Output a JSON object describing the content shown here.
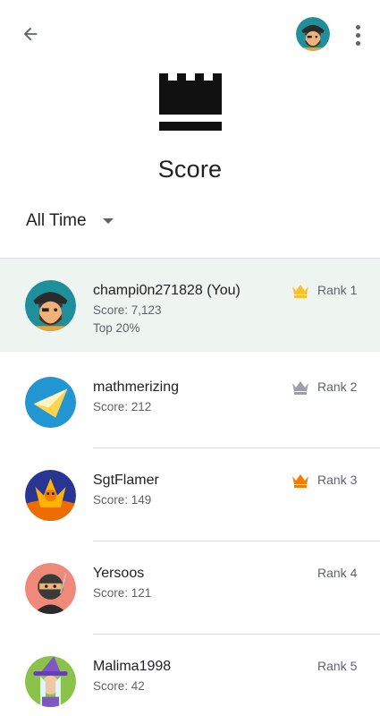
{
  "header": {
    "back_icon": "arrow-back-icon",
    "profile_avatar": "pirate-avatar",
    "more_icon": "more-vert-icon"
  },
  "page": {
    "title": "Score",
    "icon": "crown-icon"
  },
  "filter": {
    "selected": "All Time",
    "icon": "dropdown-caret-icon"
  },
  "colors": {
    "accent_gold": "#FBC02D",
    "accent_silver": "#9AA0A6",
    "accent_bronze": "#F57C00",
    "highlight_row": "#EEF5F1"
  },
  "leaderboard": [
    {
      "name": "champi0n271828 (You)",
      "score": "Score: 7,123",
      "top": "Top 20%",
      "rank": "Rank 1",
      "crown": "gold",
      "avatar": "pirate"
    },
    {
      "name": "mathmerizing",
      "score": "Score: 212",
      "rank": "Rank 2",
      "crown": "silver",
      "avatar": "paper-plane"
    },
    {
      "name": "SgtFlamer",
      "score": "Score: 149",
      "rank": "Rank 3",
      "crown": "bronze",
      "avatar": "phoenix"
    },
    {
      "name": "Yersoos",
      "score": "Score: 121",
      "rank": "Rank 4",
      "crown": "none",
      "avatar": "ninja"
    },
    {
      "name": "Malima1998",
      "score": "Score: 42",
      "rank": "Rank 5",
      "crown": "none",
      "avatar": "witch"
    }
  ]
}
